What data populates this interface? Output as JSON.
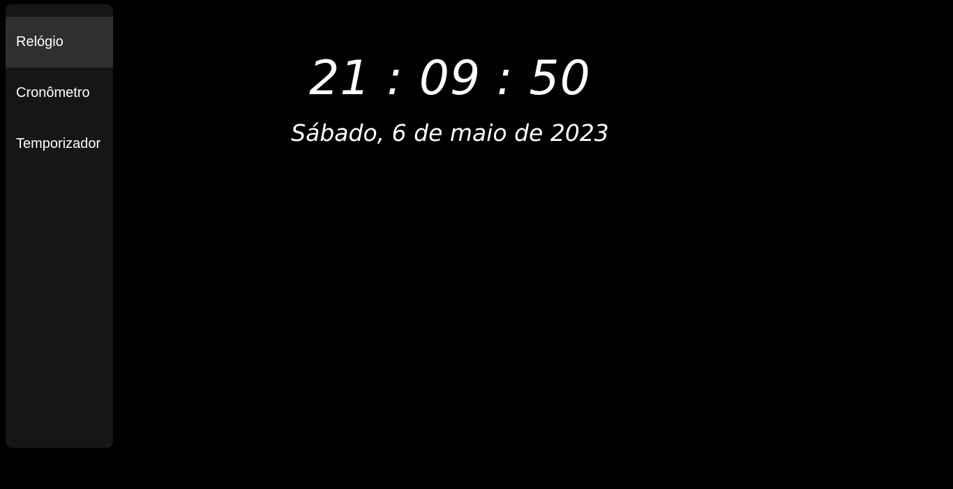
{
  "sidebar": {
    "items": [
      {
        "label": "Relógio",
        "active": true
      },
      {
        "label": "Cronômetro",
        "active": false
      },
      {
        "label": "Temporizador",
        "active": false
      }
    ]
  },
  "clock": {
    "time": "21 : 09 : 50",
    "date": "Sábado, 6 de maio de 2023"
  },
  "colors": {
    "background": "#000000",
    "sidebar": "#161616",
    "active_item": "#2f2f2f",
    "text": "#ffffff"
  }
}
